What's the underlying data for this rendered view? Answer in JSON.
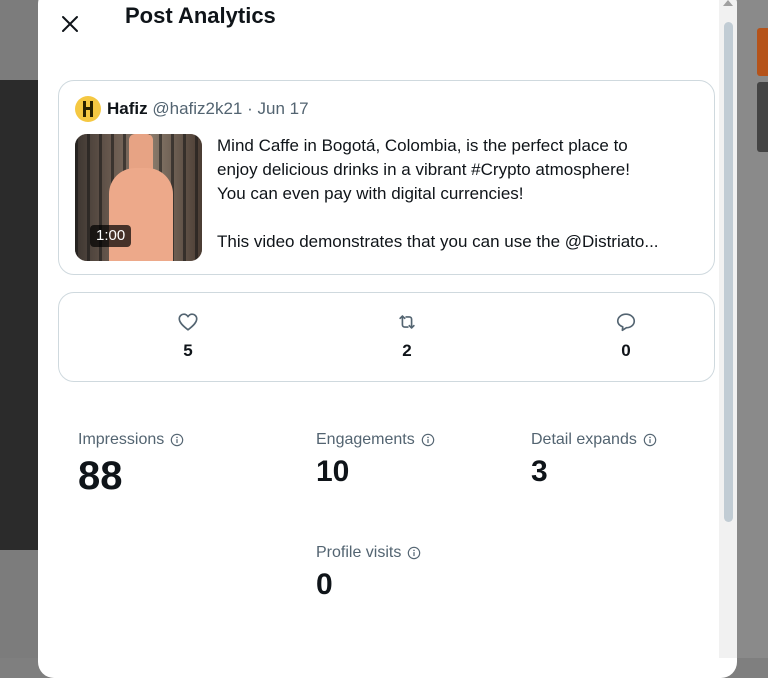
{
  "modal": {
    "title": "Post Analytics"
  },
  "tweet": {
    "author_name": "Hafiz",
    "author_handle": "@hafiz2k21",
    "separator": "·",
    "date": "Jun 17",
    "video_duration": "1:00",
    "text_lines": [
      "Mind Caffe in Bogotá, Colombia, is the perfect place to",
      "enjoy delicious drinks in a vibrant #Crypto atmosphere!",
      "You can even pay with digital currencies!"
    ],
    "text_line_truncated": "This video demonstrates that you can use the @Distriato..."
  },
  "engagement_bar": {
    "likes": "5",
    "reposts": "2",
    "replies": "0"
  },
  "stats": {
    "impressions": {
      "label": "Impressions",
      "value": "88"
    },
    "engagements": {
      "label": "Engagements",
      "value": "10"
    },
    "detail_expands": {
      "label": "Detail expands",
      "value": "3"
    },
    "profile_visits": {
      "label": "Profile visits",
      "value": "0"
    }
  },
  "icons": {
    "close": "close-icon",
    "like": "heart-icon",
    "repost": "repost-icon",
    "reply": "reply-icon",
    "info": "info-icon"
  },
  "colors": {
    "text_primary": "#0f1419",
    "text_secondary": "#536471",
    "border": "#cfd9de"
  }
}
